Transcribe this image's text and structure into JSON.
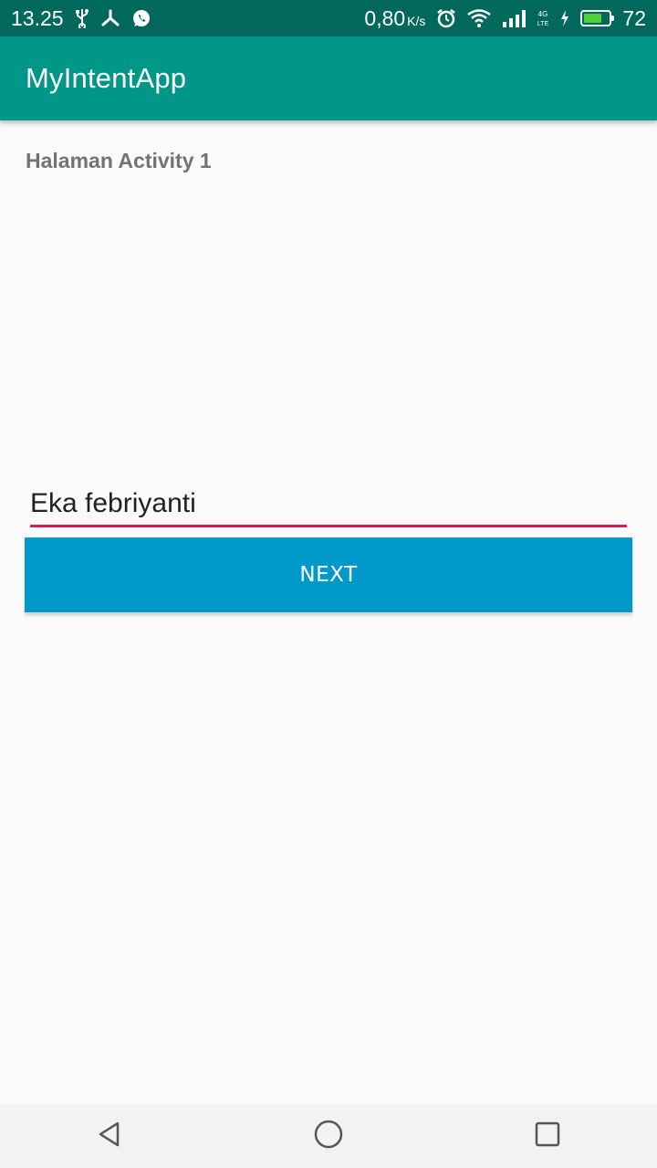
{
  "status_bar": {
    "time": "13.25",
    "net_speed": "0,80",
    "net_unit": "K/s",
    "network_type": "4G LTE",
    "battery_level": "72",
    "battery_fraction": 0.72,
    "icons": [
      "usb-icon",
      "share-icon",
      "whatsapp-icon",
      "alarm-icon",
      "wifi-icon",
      "signal-icon",
      "charging-icon",
      "battery-icon"
    ]
  },
  "app_bar": {
    "title": "MyIntentApp"
  },
  "main": {
    "heading": "Halaman Activity 1",
    "name_input_value": "Eka febriyanti",
    "next_button_label": "NEXT"
  },
  "nav_bar": {
    "icons": [
      "back-icon",
      "home-icon",
      "recents-icon"
    ]
  },
  "colors": {
    "status_bar": "#00695c",
    "app_bar": "#009688",
    "accent_underline": "#d81b60",
    "button": "#0099cc",
    "background": "#fafafa"
  }
}
